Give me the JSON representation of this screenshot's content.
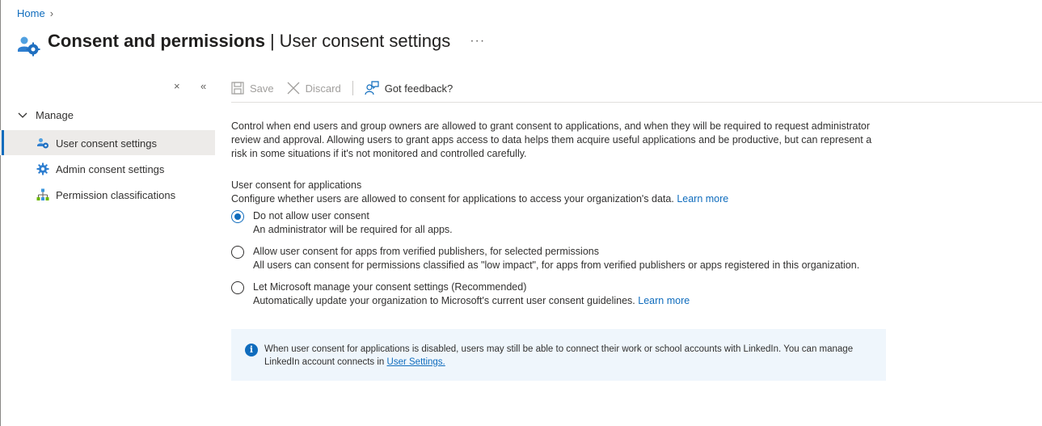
{
  "breadcrumb": {
    "home": "Home",
    "separator": "›"
  },
  "header": {
    "title_main": "Consent and permissions",
    "separator": "|",
    "title_sub": "User consent settings",
    "more": "···",
    "icon": "users-gear-icon"
  },
  "sidebar": {
    "close": "×",
    "collapse": "«",
    "group_label": "Manage",
    "items": [
      {
        "label": "User consent settings",
        "icon": "users-gear-icon",
        "active": true
      },
      {
        "label": "Admin consent settings",
        "icon": "gear-icon",
        "active": false
      },
      {
        "label": "Permission classifications",
        "icon": "hierarchy-icon",
        "active": false
      }
    ]
  },
  "toolbar": {
    "save": "Save",
    "discard": "Discard",
    "feedback": "Got feedback?"
  },
  "content": {
    "description": "Control when end users and group owners are allowed to grant consent to applications, and when they will be required to request administrator review and approval. Allowing users to grant apps access to data helps them acquire useful applications and be productive, but can represent a risk in some situations if it's not monitored and controlled carefully.",
    "section_title": "User consent for applications",
    "section_desc": "Configure whether users are allowed to consent for applications to access your organization's data.",
    "learn_more": "Learn more",
    "options": [
      {
        "label": "Do not allow user consent",
        "desc": "An administrator will be required for all apps.",
        "checked": true
      },
      {
        "label": "Allow user consent for apps from verified publishers, for selected permissions",
        "desc": "All users can consent for permissions classified as \"low impact\", for apps from verified publishers or apps registered in this organization.",
        "checked": false
      },
      {
        "label": "Let Microsoft manage your consent settings (Recommended)",
        "desc": "Automatically update your organization to Microsoft's current user consent guidelines.",
        "checked": false,
        "link": "Learn more"
      }
    ]
  },
  "info": {
    "text": "When user consent for applications is disabled, users may still be able to connect their work or school accounts with LinkedIn. You can manage LinkedIn account connects in",
    "link": "User Settings."
  },
  "colors": {
    "accent": "#0f6cbd",
    "active_bg": "#edebe9",
    "info_bg": "#eff6fc"
  }
}
